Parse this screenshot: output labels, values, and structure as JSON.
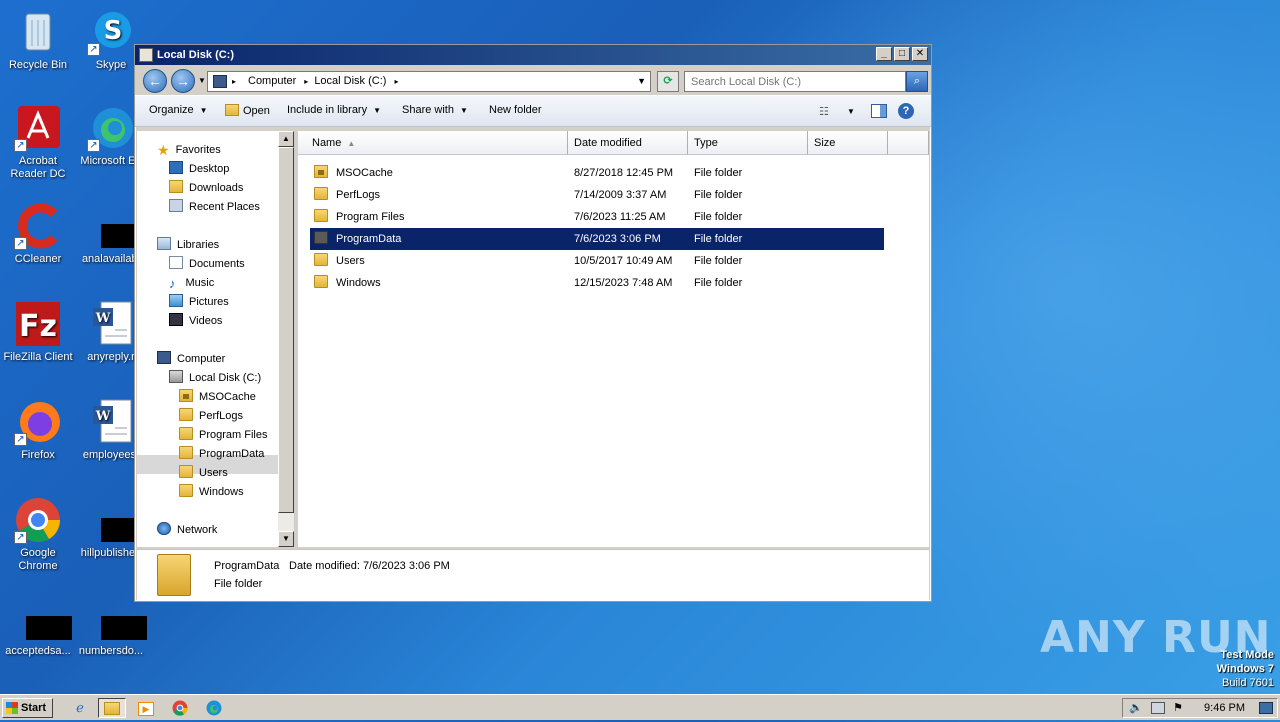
{
  "desktop": {
    "icons": [
      {
        "label": "Recycle Bin"
      },
      {
        "label": "Skype"
      },
      {
        "label": "Acrobat Reader DC"
      },
      {
        "label": "Microsoft Ed"
      },
      {
        "label": "CCleaner"
      },
      {
        "label": "analavailabl"
      },
      {
        "label": "FileZilla Client"
      },
      {
        "label": "anyreply.r"
      },
      {
        "label": "Firefox"
      },
      {
        "label": "employees."
      },
      {
        "label": "Google Chrome"
      },
      {
        "label": "hillpublished"
      },
      {
        "label": "acceptedsa..."
      },
      {
        "label": "numbersdo..."
      }
    ],
    "watermark": "ANY RUN",
    "testmode": {
      "line1": "Test Mode",
      "line2": "Windows 7",
      "line3": "Build 7601"
    }
  },
  "window": {
    "title": "Local Disk (C:)",
    "controls": {
      "minimize": "_",
      "maximize": "□",
      "close": "✕"
    },
    "address": {
      "crumbs": [
        "Computer",
        "Local Disk (C:)"
      ]
    },
    "search": {
      "placeholder": "Search Local Disk (C:)"
    },
    "toolbar": {
      "organize": "Organize",
      "open": "Open",
      "include": "Include in library",
      "share": "Share with",
      "newfolder": "New folder"
    },
    "nav": {
      "favorites": "Favorites",
      "desktop": "Desktop",
      "downloads": "Downloads",
      "recent": "Recent Places",
      "libraries": "Libraries",
      "documents": "Documents",
      "music": "Music",
      "pictures": "Pictures",
      "videos": "Videos",
      "computer": "Computer",
      "localdisk": "Local Disk (C:)",
      "sub": [
        "MSOCache",
        "PerfLogs",
        "Program Files",
        "ProgramData",
        "Users",
        "Windows"
      ],
      "network": "Network"
    },
    "columns": {
      "name": "Name",
      "date": "Date modified",
      "type": "Type",
      "size": "Size"
    },
    "files": [
      {
        "name": "MSOCache",
        "date": "8/27/2018 12:45 PM",
        "type": "File folder"
      },
      {
        "name": "PerfLogs",
        "date": "7/14/2009 3:37 AM",
        "type": "File folder"
      },
      {
        "name": "Program Files",
        "date": "7/6/2023 11:25 AM",
        "type": "File folder"
      },
      {
        "name": "ProgramData",
        "date": "7/6/2023 3:06 PM",
        "type": "File folder"
      },
      {
        "name": "Users",
        "date": "10/5/2017 10:49 AM",
        "type": "File folder"
      },
      {
        "name": "Windows",
        "date": "12/15/2023 7:48 AM",
        "type": "File folder"
      }
    ],
    "details": {
      "name": "ProgramData",
      "modified": "Date modified:  7/6/2023 3:06 PM",
      "type": "File folder"
    }
  },
  "taskbar": {
    "start": "Start",
    "clock": "9:46 PM"
  }
}
